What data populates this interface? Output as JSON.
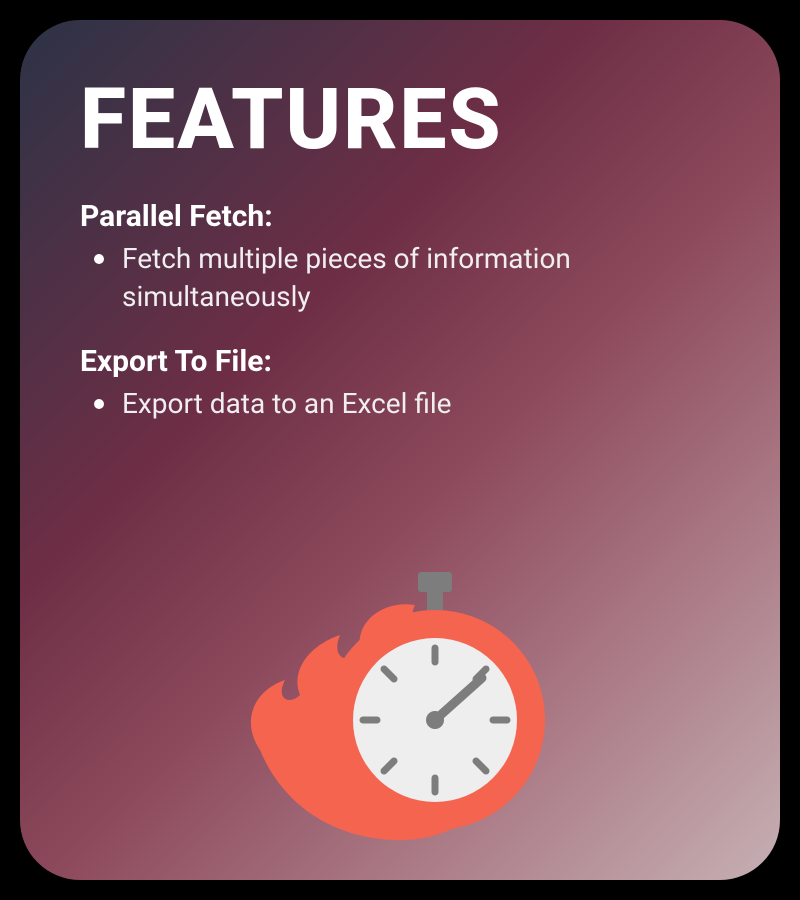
{
  "title": "FEATURES",
  "features": [
    {
      "label": "Parallel Fetch:",
      "item": "Fetch multiple pieces of information simultaneously"
    },
    {
      "label": "Export To File:",
      "item": "Export data to an Excel file"
    }
  ],
  "icon_name": "stopwatch-flame-icon",
  "colors": {
    "flame": "#f5644f",
    "clock_face": "#eeeeee",
    "clock_detail": "#7d7d7d"
  }
}
